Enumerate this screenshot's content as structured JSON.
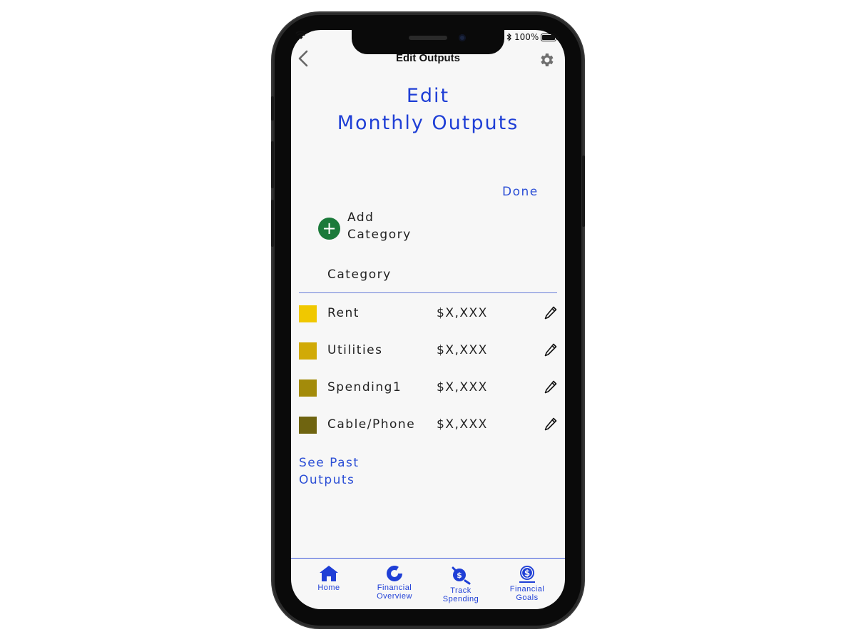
{
  "status_bar": {
    "battery": "100%"
  },
  "header": {
    "title": "Edit Outputs"
  },
  "page_title": {
    "line1": "Edit",
    "line2": "Monthly Outputs"
  },
  "done_label": "Done",
  "add_category": {
    "line1": "Add",
    "line2": "Category"
  },
  "column_header": "Category",
  "categories": [
    {
      "name": "Rent",
      "amount": "$X,XXX",
      "color": "#f0c800"
    },
    {
      "name": "Utilities",
      "amount": "$X,XXX",
      "color": "#d1aa06"
    },
    {
      "name": "Spending1",
      "amount": "$X,XXX",
      "color": "#a38b0a"
    },
    {
      "name": "Cable/Phone",
      "amount": "$X,XXX",
      "color": "#6f6410"
    }
  ],
  "see_past": {
    "line1": "See Past",
    "line2": "Outputs"
  },
  "tabs": [
    {
      "line1": "Home",
      "line2": ""
    },
    {
      "line1": "Financial",
      "line2": "Overview"
    },
    {
      "line1": "Track",
      "line2": "Spending"
    },
    {
      "line1": "Financial",
      "line2": "Goals"
    }
  ],
  "colors": {
    "accent": "#1f3fd6",
    "add_button": "#1b7a3a"
  }
}
